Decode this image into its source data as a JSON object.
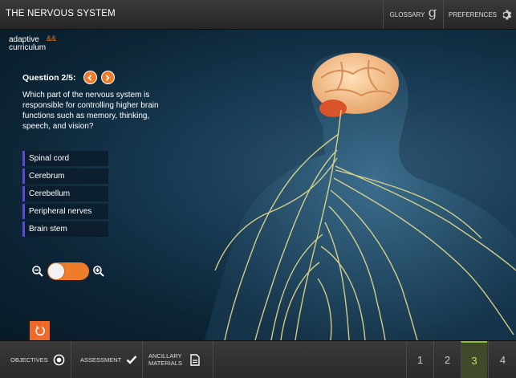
{
  "header": {
    "title": "THE NERVOUS SYSTEM",
    "glossary_label": "GLOSSARY",
    "glossary_glyph": "g",
    "preferences_label": "PREFERENCES"
  },
  "logo": {
    "line1": "adaptive",
    "line2": "curriculum",
    "mark": "&&"
  },
  "question": {
    "number_label": "Question 2/5:",
    "text": "Which part of the nervous system is responsible for controlling higher brain functions such as memory, thinking, speech, and vision?",
    "answers": [
      "Spinal cord",
      "Cerebrum",
      "Cerebellum",
      "Peripheral nerves",
      "Brain stem"
    ]
  },
  "zoom": {
    "level": 0
  },
  "footer": {
    "objectives_label": "OBJECTIVES",
    "assessment_label": "ASSESSMENT",
    "ancillary_line1": "ANCILLARY",
    "ancillary_line2": "MATERIALS",
    "pages": [
      "1",
      "2",
      "3",
      "4"
    ],
    "active_page": "3"
  },
  "colors": {
    "accent": "#ef7c2a",
    "answer_border": "#5a4bd1",
    "active_page": "#cfdc5a"
  },
  "icons": [
    "gear-icon",
    "chevron-left-icon",
    "chevron-right-icon",
    "zoom-out-icon",
    "zoom-in-icon",
    "reset-icon",
    "target-icon",
    "checkmark-icon",
    "document-icon"
  ]
}
